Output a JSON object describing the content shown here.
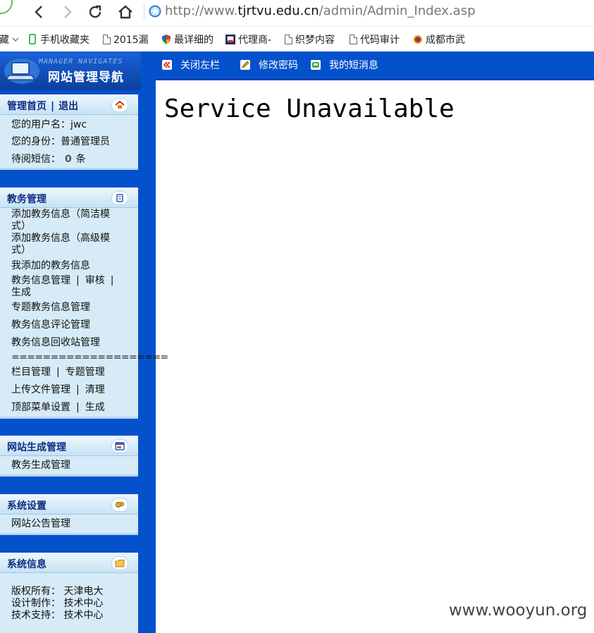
{
  "browser": {
    "url_prefix": "http://www.",
    "url_domain": "tjrtvu.edu.cn",
    "url_path": "/admin/Admin_Index.asp",
    "bookmarks": [
      {
        "label": "藏",
        "icon": "chevron-down-icon"
      },
      {
        "label": "手机收藏夹",
        "icon": "phone-icon"
      },
      {
        "label": "2015漏",
        "icon": "page-icon"
      },
      {
        "label": "最详细的",
        "icon": "shield-icon"
      },
      {
        "label": "代理商-",
        "icon": "site-favicon-icon"
      },
      {
        "label": "织梦内容",
        "icon": "page-icon"
      },
      {
        "label": "代码审计",
        "icon": "page-icon"
      },
      {
        "label": "成都市武",
        "icon": "emblem-icon"
      }
    ]
  },
  "logo": {
    "subtitle": "MANAGER NAVIGATES",
    "title": "网站管理导航"
  },
  "toolbar": {
    "close_left": "关闭左栏",
    "change_password": "修改密码",
    "my_messages": "我的短消息"
  },
  "sidebar": {
    "account": {
      "home": "管理首页",
      "separator": "|",
      "logout": "退出",
      "username": "您的用户名：jwc",
      "role": "您的身份：普通管理员",
      "unread_prefix": "待阅短信：",
      "unread_count": "0",
      "unread_suffix": "条"
    },
    "academic": {
      "title": "教务管理",
      "items": [
        "添加教务信息（简洁模式）",
        "添加教务信息（高级模式）",
        "我添加的教务信息",
        "教务信息管理",
        "|",
        "审核",
        "|",
        "生成",
        "专题教务信息管理",
        "教务信息评论管理",
        "教务信息回收站管理",
        "====================",
        "栏目管理",
        "|",
        "专题管理",
        "上传文件管理",
        "|",
        "清理",
        "顶部菜单设置",
        "|",
        "生成"
      ]
    },
    "site_gen": {
      "title": "网站生成管理",
      "item": "教务生成管理"
    },
    "settings": {
      "title": "系统设置",
      "item": "网站公告管理"
    },
    "info": {
      "title": "系统信息",
      "copyright_label": "版权所有：",
      "copyright_value": "天津电大",
      "design_label": "设计制作：",
      "design_value": "技术中心",
      "support_label": "技术支持：",
      "support_value": "技术中心"
    }
  },
  "main": {
    "message": "Service Unavailable"
  },
  "watermark": "www.wooyun.org"
}
